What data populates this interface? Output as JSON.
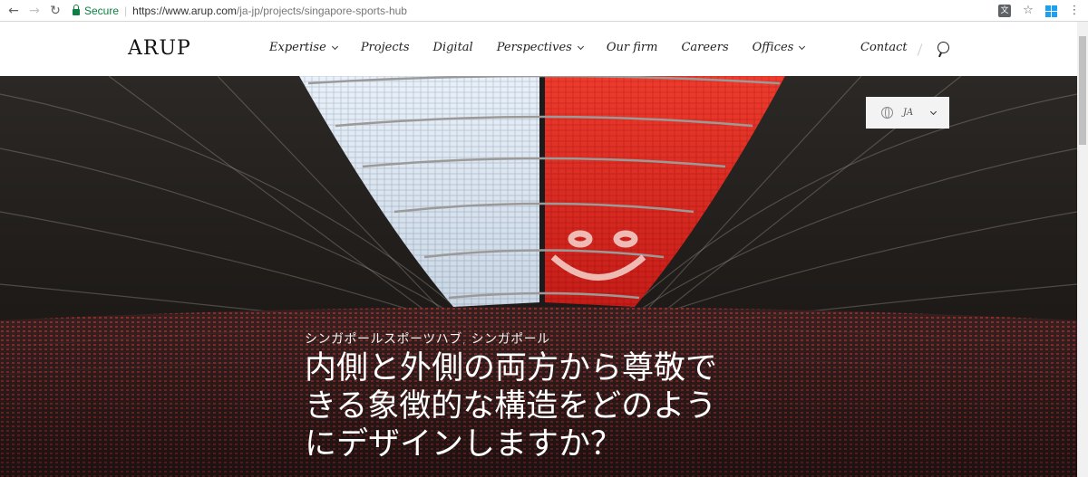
{
  "browser": {
    "secure_label": "Secure",
    "url_host": "https://www.arup.com",
    "url_path": "/ja-jp/projects/singapore-sports-hub",
    "icons": [
      "back-arrow-icon",
      "forward-arrow-icon",
      "reload-icon",
      "translate-icon",
      "star-icon",
      "windows-icon",
      "menu-icon"
    ]
  },
  "header": {
    "logo": "ARUP",
    "nav": [
      {
        "label": "Expertise",
        "dropdown": true
      },
      {
        "label": "Projects",
        "dropdown": false
      },
      {
        "label": "Digital",
        "dropdown": false
      },
      {
        "label": "Perspectives",
        "dropdown": true
      },
      {
        "label": "Our firm",
        "dropdown": false
      },
      {
        "label": "Careers",
        "dropdown": false
      },
      {
        "label": "Offices",
        "dropdown": true
      }
    ],
    "contact": "Contact"
  },
  "hero": {
    "language": "JA",
    "kicker": "シンガポールスポーツハブ, シンガポール",
    "headline": "内側と外側の両方から尊敬できる象徴的な構造をどのようにデザインしますか？",
    "colors": {
      "roof_white": "#d9e8f7",
      "roof_red": "#e8261e",
      "seats": "#8a2a2a"
    }
  }
}
